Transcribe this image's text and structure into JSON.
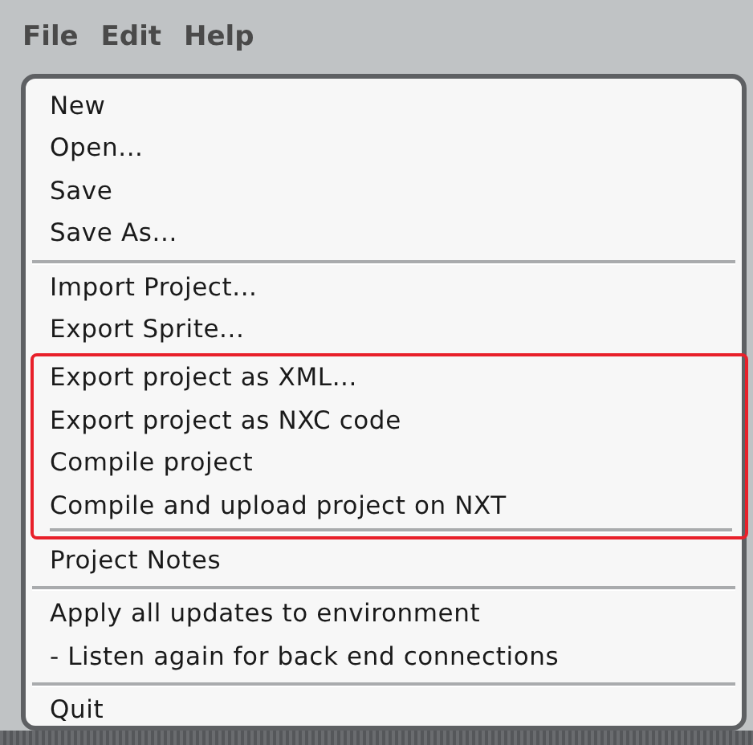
{
  "menu_bar": [
    "File",
    "Edit",
    "Help"
  ],
  "menu": {
    "groups": [
      {
        "highlighted": false,
        "items": [
          "New",
          "Open...",
          "Save",
          "Save As..."
        ]
      },
      {
        "highlighted": false,
        "items": [
          "Import Project...",
          "Export Sprite..."
        ]
      },
      {
        "highlighted": true,
        "items": [
          "Export project as XML...",
          "Export project as NXC code",
          "Compile project",
          "Compile and upload project on NXT"
        ]
      },
      {
        "highlighted": false,
        "items": [
          "Project Notes"
        ]
      },
      {
        "highlighted": false,
        "items": [
          "Apply all updates to environment",
          "- Listen again for back end connections"
        ]
      },
      {
        "highlighted": false,
        "items": [
          "Quit"
        ]
      }
    ]
  }
}
